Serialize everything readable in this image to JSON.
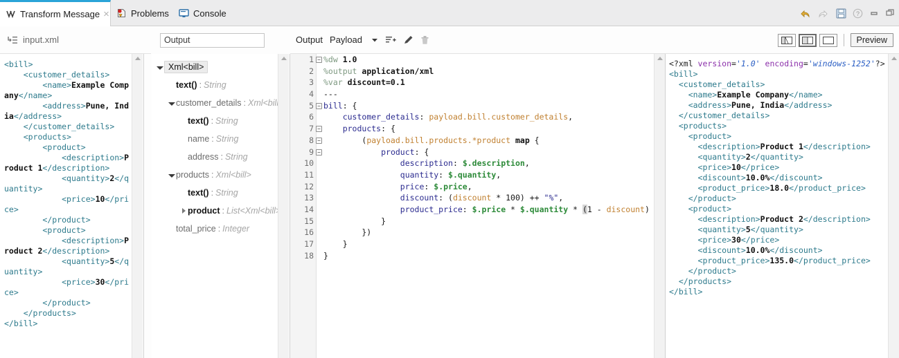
{
  "window": {
    "controls": [
      {
        "name": "undo-icon",
        "label": "Undo"
      },
      {
        "name": "redo-icon",
        "label": "Redo"
      },
      {
        "name": "save-icon",
        "label": "Save"
      },
      {
        "name": "help-icon",
        "label": "Help"
      },
      {
        "name": "minimize-icon",
        "label": "Minimize"
      },
      {
        "name": "maximize-icon",
        "label": "Maximize"
      }
    ]
  },
  "tabs": {
    "active": {
      "label": "Transform Message",
      "icon": "transform-icon",
      "close": "×"
    },
    "others": [
      {
        "label": "Problems",
        "icon": "problems-icon"
      },
      {
        "label": "Console",
        "icon": "console-icon"
      }
    ]
  },
  "input_panel": {
    "header_label": "input.xml",
    "header_icon": "indent-tree-icon",
    "lines": [
      [
        {
          "t": "tag",
          "v": "<bill>"
        }
      ],
      [
        {
          "t": "tag",
          "v": "    <customer_details>"
        }
      ],
      [
        {
          "t": "tag",
          "v": "        <name>"
        },
        {
          "t": "txt",
          "v": "Example Company"
        },
        {
          "t": "tag",
          "v": "</name>"
        }
      ],
      [
        {
          "t": "tag",
          "v": "        <address>"
        },
        {
          "t": "txt",
          "v": "Pune, India"
        },
        {
          "t": "tag",
          "v": "</address>"
        }
      ],
      [
        {
          "t": "tag",
          "v": "    </customer_details>"
        }
      ],
      [
        {
          "t": "tag",
          "v": "    <products>"
        }
      ],
      [
        {
          "t": "tag",
          "v": "        <product>"
        }
      ],
      [
        {
          "t": "tag",
          "v": "            <description>"
        },
        {
          "t": "txt",
          "v": "Product 1"
        },
        {
          "t": "tag",
          "v": "</description>"
        }
      ],
      [
        {
          "t": "tag",
          "v": "            <quantity>"
        },
        {
          "t": "txt",
          "v": "2"
        },
        {
          "t": "tag",
          "v": "</quantity>"
        }
      ],
      [
        {
          "t": "tag",
          "v": "            <price>"
        },
        {
          "t": "txt",
          "v": "10"
        },
        {
          "t": "tag",
          "v": "</price>"
        }
      ],
      [
        {
          "t": "tag",
          "v": "        </product>"
        }
      ],
      [
        {
          "t": "tag",
          "v": "        <product>"
        }
      ],
      [
        {
          "t": "tag",
          "v": "            <description>"
        },
        {
          "t": "txt",
          "v": "Product 2"
        },
        {
          "t": "tag",
          "v": "</description>"
        }
      ],
      [
        {
          "t": "tag",
          "v": "            <quantity>"
        },
        {
          "t": "txt",
          "v": "5"
        },
        {
          "t": "tag",
          "v": "</quantity>"
        }
      ],
      [
        {
          "t": "tag",
          "v": "            <price>"
        },
        {
          "t": "txt",
          "v": "30"
        },
        {
          "t": "tag",
          "v": "</price>"
        }
      ],
      [
        {
          "t": "tag",
          "v": "        </product>"
        }
      ],
      [
        {
          "t": "tag",
          "v": "    </products>"
        }
      ],
      [
        {
          "t": "tag",
          "v": "</bill>"
        }
      ]
    ]
  },
  "tree_panel": {
    "output_field_value": "Output",
    "nodes": [
      {
        "indent": 0,
        "twist": "down",
        "label": "Xml<bill>",
        "chip": true,
        "bold": true,
        "type": ""
      },
      {
        "indent": 1,
        "twist": "none",
        "label": "text()",
        "chip": false,
        "bold": true,
        "type": "String"
      },
      {
        "indent": 1,
        "twist": "down",
        "label": "customer_details",
        "chip": false,
        "bold": false,
        "type": "Xml<bill>"
      },
      {
        "indent": 2,
        "twist": "none",
        "label": "text()",
        "chip": false,
        "bold": true,
        "type": "String"
      },
      {
        "indent": 2,
        "twist": "none",
        "label": "name",
        "chip": false,
        "bold": false,
        "type": "String"
      },
      {
        "indent": 2,
        "twist": "none",
        "label": "address",
        "chip": false,
        "bold": false,
        "type": "String"
      },
      {
        "indent": 1,
        "twist": "down",
        "label": "products",
        "chip": false,
        "bold": false,
        "type": "Xml<bill>"
      },
      {
        "indent": 2,
        "twist": "none",
        "label": "text()",
        "chip": false,
        "bold": true,
        "type": "String"
      },
      {
        "indent": 2,
        "twist": "right",
        "label": "product",
        "chip": false,
        "bold": true,
        "type": "List<Xml<bill>>"
      },
      {
        "indent": 1,
        "twist": "none",
        "label": "total_price",
        "chip": false,
        "bold": false,
        "type": "Integer"
      }
    ]
  },
  "editor_toolbar": {
    "output_label": "Output",
    "payload_label": "Payload",
    "icons": [
      {
        "name": "chevron-down-icon"
      },
      {
        "name": "add-list-icon"
      },
      {
        "name": "edit-pencil-icon"
      },
      {
        "name": "delete-trash-icon"
      }
    ],
    "layout_buttons": [
      {
        "name": "layout-single-pane-button",
        "selected": false
      },
      {
        "name": "layout-split-pane-button",
        "selected": true
      },
      {
        "name": "layout-full-pane-button",
        "selected": false
      }
    ],
    "preview_label": "Preview"
  },
  "code_editor": {
    "line_numbers": [
      1,
      2,
      3,
      4,
      5,
      6,
      7,
      8,
      9,
      10,
      11,
      12,
      13,
      14,
      15,
      16,
      17,
      18
    ],
    "fold_lines": [
      1,
      5,
      7,
      8,
      9
    ],
    "lines": [
      [
        {
          "c": "dir",
          "v": "%dw "
        },
        {
          "c": "val",
          "v": "1.0"
        }
      ],
      [
        {
          "c": "dir",
          "v": "%output "
        },
        {
          "c": "val",
          "v": "application/xml"
        }
      ],
      [
        {
          "c": "dir",
          "v": "%var "
        },
        {
          "c": "val",
          "v": "discount=0.1"
        }
      ],
      [
        {
          "c": "plain",
          "v": "---"
        }
      ],
      [
        {
          "c": "key",
          "v": "bill"
        },
        {
          "c": "plain",
          "v": ": {"
        }
      ],
      [
        {
          "c": "plain",
          "v": "    "
        },
        {
          "c": "key",
          "v": "customer_details"
        },
        {
          "c": "plain",
          "v": ": "
        },
        {
          "c": "pay",
          "v": "payload.bill.customer_details"
        },
        {
          "c": "plain",
          "v": ","
        }
      ],
      [
        {
          "c": "plain",
          "v": "    "
        },
        {
          "c": "key",
          "v": "products"
        },
        {
          "c": "plain",
          "v": ": {"
        }
      ],
      [
        {
          "c": "plain",
          "v": "        ("
        },
        {
          "c": "pay",
          "v": "payload.bill.products.*product"
        },
        {
          "c": "plain",
          "v": " "
        },
        {
          "c": "map",
          "v": "map"
        },
        {
          "c": "plain",
          "v": " {"
        }
      ],
      [
        {
          "c": "plain",
          "v": "            "
        },
        {
          "c": "key",
          "v": "product"
        },
        {
          "c": "plain",
          "v": ": {"
        }
      ],
      [
        {
          "c": "plain",
          "v": "                "
        },
        {
          "c": "key",
          "v": "description"
        },
        {
          "c": "plain",
          "v": ": "
        },
        {
          "c": "sel",
          "v": "$.description"
        },
        {
          "c": "plain",
          "v": ","
        }
      ],
      [
        {
          "c": "plain",
          "v": "                "
        },
        {
          "c": "key",
          "v": "quantity"
        },
        {
          "c": "plain",
          "v": ": "
        },
        {
          "c": "sel",
          "v": "$.quantity"
        },
        {
          "c": "plain",
          "v": ","
        }
      ],
      [
        {
          "c": "plain",
          "v": "                "
        },
        {
          "c": "key",
          "v": "price"
        },
        {
          "c": "plain",
          "v": ": "
        },
        {
          "c": "sel",
          "v": "$.price"
        },
        {
          "c": "plain",
          "v": ","
        }
      ],
      [
        {
          "c": "plain",
          "v": "                "
        },
        {
          "c": "key",
          "v": "discount"
        },
        {
          "c": "plain",
          "v": ": ("
        },
        {
          "c": "var",
          "v": "discount"
        },
        {
          "c": "plain",
          "v": " * 100) ++ "
        },
        {
          "c": "str",
          "v": "\"%\""
        },
        {
          "c": "plain",
          "v": ","
        }
      ],
      [
        {
          "c": "plain",
          "v": "                "
        },
        {
          "c": "key",
          "v": "product_price"
        },
        {
          "c": "plain",
          "v": ": "
        },
        {
          "c": "sel",
          "v": "$.price"
        },
        {
          "c": "plain",
          "v": " * "
        },
        {
          "c": "sel",
          "v": "$.quantity"
        },
        {
          "c": "plain",
          "v": " * "
        },
        {
          "c": "cur",
          "v": "("
        },
        {
          "c": "plain",
          "v": "1 - "
        },
        {
          "c": "var",
          "v": "discount"
        },
        {
          "c": "plain",
          "v": ")"
        }
      ],
      [
        {
          "c": "plain",
          "v": "            }"
        }
      ],
      [
        {
          "c": "plain",
          "v": "        })"
        }
      ],
      [
        {
          "c": "plain",
          "v": "    }"
        }
      ],
      [
        {
          "c": "plain",
          "v": "}"
        }
      ]
    ]
  },
  "output_panel": {
    "lines": [
      [
        {
          "t": "pi",
          "v": "<?xml "
        },
        {
          "t": "attr",
          "v": "version"
        },
        {
          "t": "pi",
          "v": "="
        },
        {
          "t": "aval",
          "v": "'1.0'"
        },
        {
          "t": "pi",
          "v": " "
        },
        {
          "t": "attr",
          "v": "encoding"
        },
        {
          "t": "pi",
          "v": "="
        },
        {
          "t": "aval",
          "v": "'windows-1252'"
        },
        {
          "t": "pi",
          "v": "?>"
        }
      ],
      [
        {
          "t": "tag",
          "v": "<bill>"
        }
      ],
      [
        {
          "t": "tag",
          "v": "  <customer_details>"
        }
      ],
      [
        {
          "t": "tag",
          "v": "    <name>"
        },
        {
          "t": "txt",
          "v": "Example Company"
        },
        {
          "t": "tag",
          "v": "</name>"
        }
      ],
      [
        {
          "t": "tag",
          "v": "    <address>"
        },
        {
          "t": "txt",
          "v": "Pune, India"
        },
        {
          "t": "tag",
          "v": "</address>"
        }
      ],
      [
        {
          "t": "tag",
          "v": "  </customer_details>"
        }
      ],
      [
        {
          "t": "tag",
          "v": "  <products>"
        }
      ],
      [
        {
          "t": "tag",
          "v": "    <product>"
        }
      ],
      [
        {
          "t": "tag",
          "v": "      <description>"
        },
        {
          "t": "txt",
          "v": "Product 1"
        },
        {
          "t": "tag",
          "v": "</description>"
        }
      ],
      [
        {
          "t": "tag",
          "v": "      <quantity>"
        },
        {
          "t": "txt",
          "v": "2"
        },
        {
          "t": "tag",
          "v": "</quantity>"
        }
      ],
      [
        {
          "t": "tag",
          "v": "      <price>"
        },
        {
          "t": "txt",
          "v": "10"
        },
        {
          "t": "tag",
          "v": "</price>"
        }
      ],
      [
        {
          "t": "tag",
          "v": "      <discount>"
        },
        {
          "t": "txt",
          "v": "10.0%"
        },
        {
          "t": "tag",
          "v": "</discount>"
        }
      ],
      [
        {
          "t": "tag",
          "v": "      <product_price>"
        },
        {
          "t": "txt",
          "v": "18.0"
        },
        {
          "t": "tag",
          "v": "</product_price>"
        }
      ],
      [
        {
          "t": "tag",
          "v": "    </product>"
        }
      ],
      [
        {
          "t": "tag",
          "v": "    <product>"
        }
      ],
      [
        {
          "t": "tag",
          "v": "      <description>"
        },
        {
          "t": "txt",
          "v": "Product 2"
        },
        {
          "t": "tag",
          "v": "</description>"
        }
      ],
      [
        {
          "t": "tag",
          "v": "      <quantity>"
        },
        {
          "t": "txt",
          "v": "5"
        },
        {
          "t": "tag",
          "v": "</quantity>"
        }
      ],
      [
        {
          "t": "tag",
          "v": "      <price>"
        },
        {
          "t": "txt",
          "v": "30"
        },
        {
          "t": "tag",
          "v": "</price>"
        }
      ],
      [
        {
          "t": "tag",
          "v": "      <discount>"
        },
        {
          "t": "txt",
          "v": "10.0%"
        },
        {
          "t": "tag",
          "v": "</discount>"
        }
      ],
      [
        {
          "t": "tag",
          "v": "      <product_price>"
        },
        {
          "t": "txt",
          "v": "135.0"
        },
        {
          "t": "tag",
          "v": "</product_price>"
        }
      ],
      [
        {
          "t": "tag",
          "v": "    </product>"
        }
      ],
      [
        {
          "t": "tag",
          "v": "  </products>"
        }
      ],
      [
        {
          "t": "tag",
          "v": "</bill>"
        }
      ]
    ]
  },
  "colors": {
    "accent_tab": "#2aa4d8",
    "xml_tag": "#2d7a8c",
    "code_key": "#2b2b8f",
    "code_payload": "#c08030",
    "code_selector": "#2e8b3a",
    "attr_name": "#8b2faa",
    "attr_value": "#2b5fc4"
  }
}
